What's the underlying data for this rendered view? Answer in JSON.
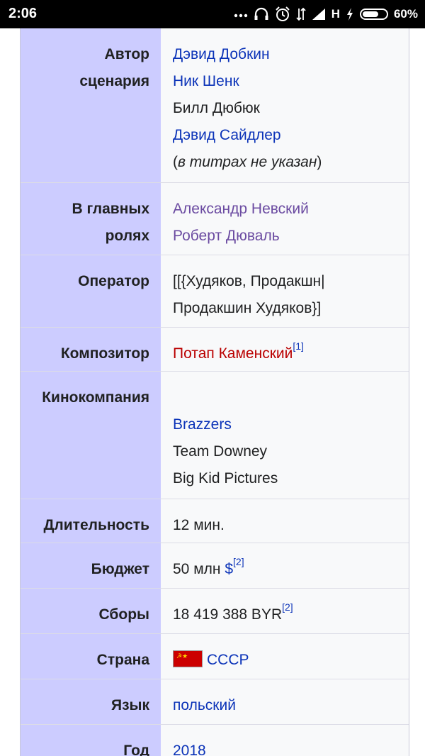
{
  "status_bar": {
    "time": "2:06",
    "network": "H",
    "battery": "60%"
  },
  "infobox": {
    "rows": [
      {
        "label": [
          "Автор",
          "сценария"
        ],
        "values": [
          {
            "text": "Дэвид Добкин",
            "kind": "link"
          },
          {
            "text": "Ник Шенк",
            "kind": "link"
          },
          {
            "text": "Билл Дюбюк",
            "kind": "plain"
          },
          {
            "text": "Дэвид Сайдлер",
            "kind": "link"
          },
          {
            "pre": "(",
            "text": "в титрах не указан",
            "post": ")",
            "kind": "italic"
          }
        ]
      },
      {
        "label": [
          "В главных",
          "ролях"
        ],
        "values": [
          {
            "text": "Александр Невский",
            "kind": "visited"
          },
          {
            "text": "Роберт Дюваль",
            "kind": "visited"
          }
        ]
      },
      {
        "label": [
          "Оператор"
        ],
        "values": [
          {
            "text": "[[{Худяков, Продакшн|",
            "kind": "plain"
          },
          {
            "text": "Продакшин Худяков}]",
            "kind": "plain"
          }
        ]
      },
      {
        "label": [
          "Композитор"
        ],
        "values": [
          {
            "text": "Потап Каменский",
            "kind": "new",
            "ref": "[1]"
          }
        ]
      },
      {
        "label": [
          "Кинокомпания"
        ],
        "values": [
          {
            "text": "",
            "kind": "plain"
          },
          {
            "text": "Brazzers",
            "kind": "link"
          },
          {
            "text": "Team Downey",
            "kind": "plain"
          },
          {
            "text": "Big Kid Pictures",
            "kind": "plain"
          }
        ]
      },
      {
        "label": [
          "Длительность"
        ],
        "values": [
          {
            "text": "12 мин.",
            "kind": "plain"
          }
        ]
      },
      {
        "label": [
          "Бюджет"
        ],
        "values": [
          {
            "pre": "50 млн ",
            "text": "$",
            "kind": "link",
            "ref": "[2]"
          }
        ]
      },
      {
        "label": [
          "Сборы"
        ],
        "values": [
          {
            "text": "18 419 388 BYR",
            "kind": "plain",
            "ref": "[2]"
          }
        ]
      },
      {
        "label": [
          "Страна"
        ],
        "values": [
          {
            "text": "СССР",
            "kind": "link",
            "flag": true
          }
        ]
      },
      {
        "label": [
          "Язык"
        ],
        "values": [
          {
            "text": "польский",
            "kind": "link"
          }
        ]
      },
      {
        "label": [
          "Год"
        ],
        "values": [
          {
            "text": "2018",
            "kind": "link"
          }
        ]
      }
    ]
  }
}
